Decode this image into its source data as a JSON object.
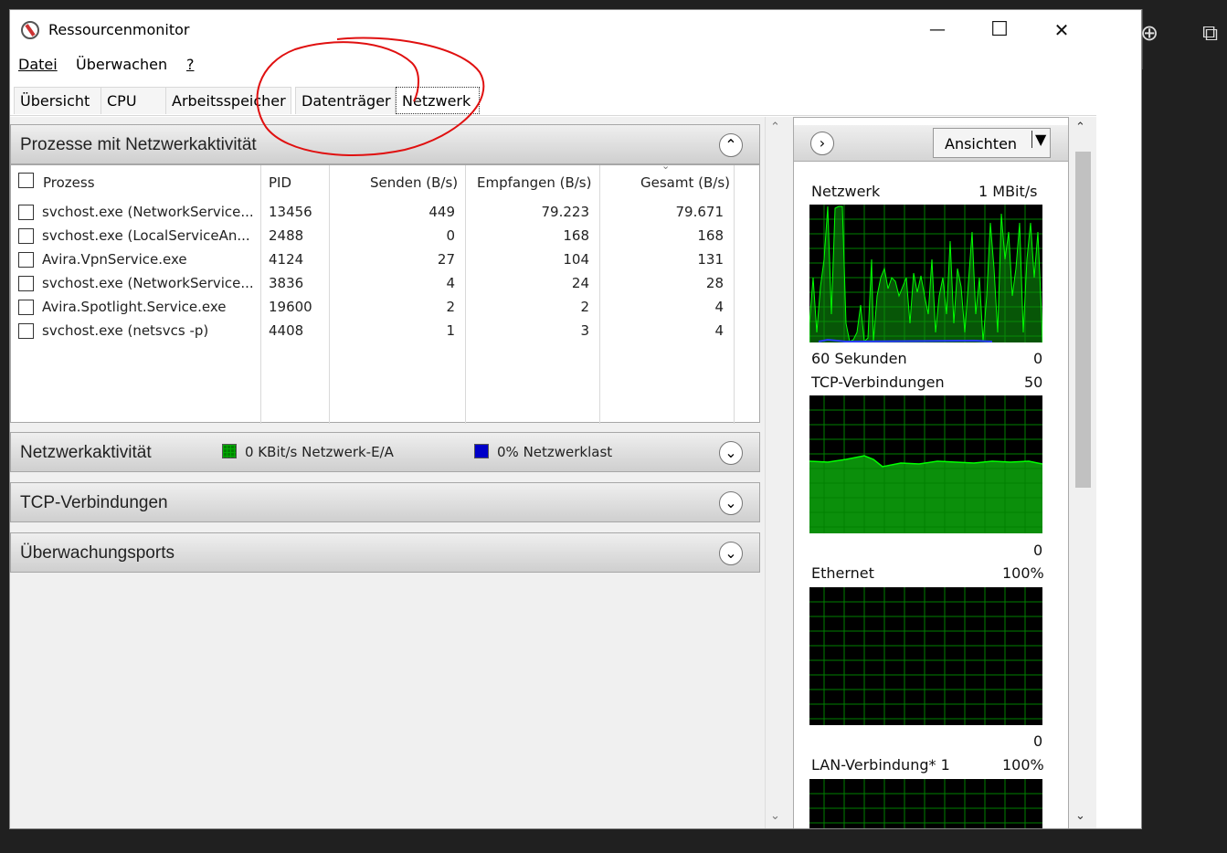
{
  "window": {
    "title": "Ressourcenmonitor",
    "min_glyph": "—",
    "max_glyph": "☐",
    "close_glyph": "✕"
  },
  "menu": {
    "items": [
      "Datei",
      "Überwachen",
      "?"
    ]
  },
  "tabs": {
    "items": [
      "Übersicht",
      "CPU",
      "Arbeitsspeicher",
      "Datenträger",
      "Netzwerk"
    ],
    "active": "Netzwerk"
  },
  "processes": {
    "title": "Prozesse mit Netzwerkaktivität",
    "columns": [
      "Prozess",
      "PID",
      "Senden (B/s)",
      "Empfangen (B/s)",
      "Gesamt (B/s)"
    ],
    "rows": [
      {
        "name": "svchost.exe (NetworkService...",
        "pid": "13456",
        "send": "449",
        "recv": "79.223",
        "total": "79.671"
      },
      {
        "name": "svchost.exe (LocalServiceAn...",
        "pid": "2488",
        "send": "0",
        "recv": "168",
        "total": "168"
      },
      {
        "name": "Avira.VpnService.exe",
        "pid": "4124",
        "send": "27",
        "recv": "104",
        "total": "131"
      },
      {
        "name": "svchost.exe (NetworkService...",
        "pid": "3836",
        "send": "4",
        "recv": "24",
        "total": "28"
      },
      {
        "name": "Avira.Spotlight.Service.exe",
        "pid": "19600",
        "send": "2",
        "recv": "2",
        "total": "4"
      },
      {
        "name": "svchost.exe (netsvcs -p)",
        "pid": "4408",
        "send": "1",
        "recv": "3",
        "total": "4"
      }
    ]
  },
  "activity": {
    "title": "Netzwerkaktivität",
    "io_label": "0 KBit/s Netzwerk-E/A",
    "load_label": "0% Netzwerklast",
    "io_color": "#008000",
    "load_color": "#0000c8"
  },
  "tcp": {
    "title": "TCP-Verbindungen"
  },
  "ports": {
    "title": "Überwachungsports"
  },
  "right": {
    "views_label": "Ansichten",
    "graphs": [
      {
        "label": "Netzwerk",
        "max": "1 MBit/s",
        "bottom_left": "60 Sekunden",
        "min": "0"
      },
      {
        "label": "TCP-Verbindungen",
        "max": "50",
        "bottom_left": "",
        "min": "0"
      },
      {
        "label": "Ethernet",
        "max": "100%",
        "bottom_left": "",
        "min": "0"
      },
      {
        "label": "LAN-Verbindung* 1",
        "max": "100%",
        "bottom_left": "",
        "min": ""
      }
    ]
  },
  "colors": {
    "graph_bg": "#000000",
    "graph_grid": "#008000",
    "graph_line": "#00ff00",
    "annotation": "#e01010"
  }
}
